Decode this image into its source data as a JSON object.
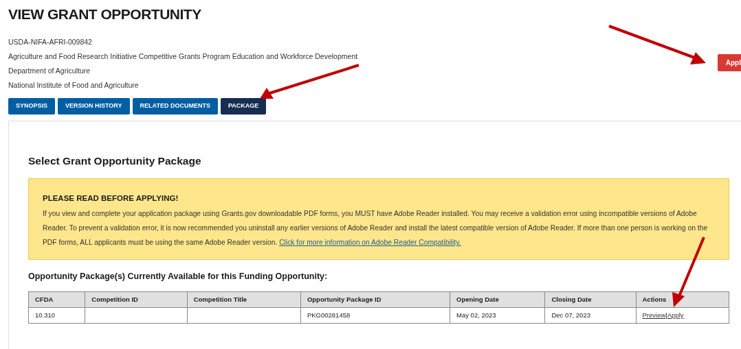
{
  "page_title": "VIEW GRANT OPPORTUNITY",
  "details": [
    "USDA-NIFA-AFRI-009842",
    "Agriculture and Food Research Initiative Competitive Grants Program Education and Workforce Development",
    "Department of Agriculture",
    "National Institute of Food and Agriculture"
  ],
  "apply_button": "Appl",
  "tabs": [
    {
      "label": "SYNOPSIS",
      "selected": false
    },
    {
      "label": "VERSION HISTORY",
      "selected": false
    },
    {
      "label": "RELATED DOCUMENTS",
      "selected": false
    },
    {
      "label": "PACKAGE",
      "selected": true
    }
  ],
  "section_title": "Select Grant Opportunity Package",
  "notice": {
    "title": "PLEASE READ BEFORE APPLYING!",
    "text": "If you view and complete your application package using Grants.gov downloadable PDF forms, you MUST have Adobe Reader installed. You may receive a validation error using incompatible versions of Adobe Reader. To prevent a validation error, it is now recommended you uninstall any earlier versions of Adobe Reader and install the latest compatible version of Adobe Reader. If more than one person is working on the PDF forms, ALL applicants must be using the same Adobe Reader version.",
    "link": "Click for more information on Adobe Reader Compatibility."
  },
  "table": {
    "caption": "Opportunity Package(s) Currently Available for this Funding Opportunity:",
    "columns": [
      "CFDA",
      "Competition ID",
      "Competition Title",
      "Opportunity Package ID",
      "Opening Date",
      "Closing Date",
      "Actions"
    ],
    "rows": [
      {
        "cells": [
          "10.310",
          null,
          null,
          "PKG00281458",
          "May 02, 2023",
          "Dec 07, 2023"
        ],
        "actions": [
          "Preview",
          "Apply"
        ],
        "separator": "|"
      }
    ]
  }
}
